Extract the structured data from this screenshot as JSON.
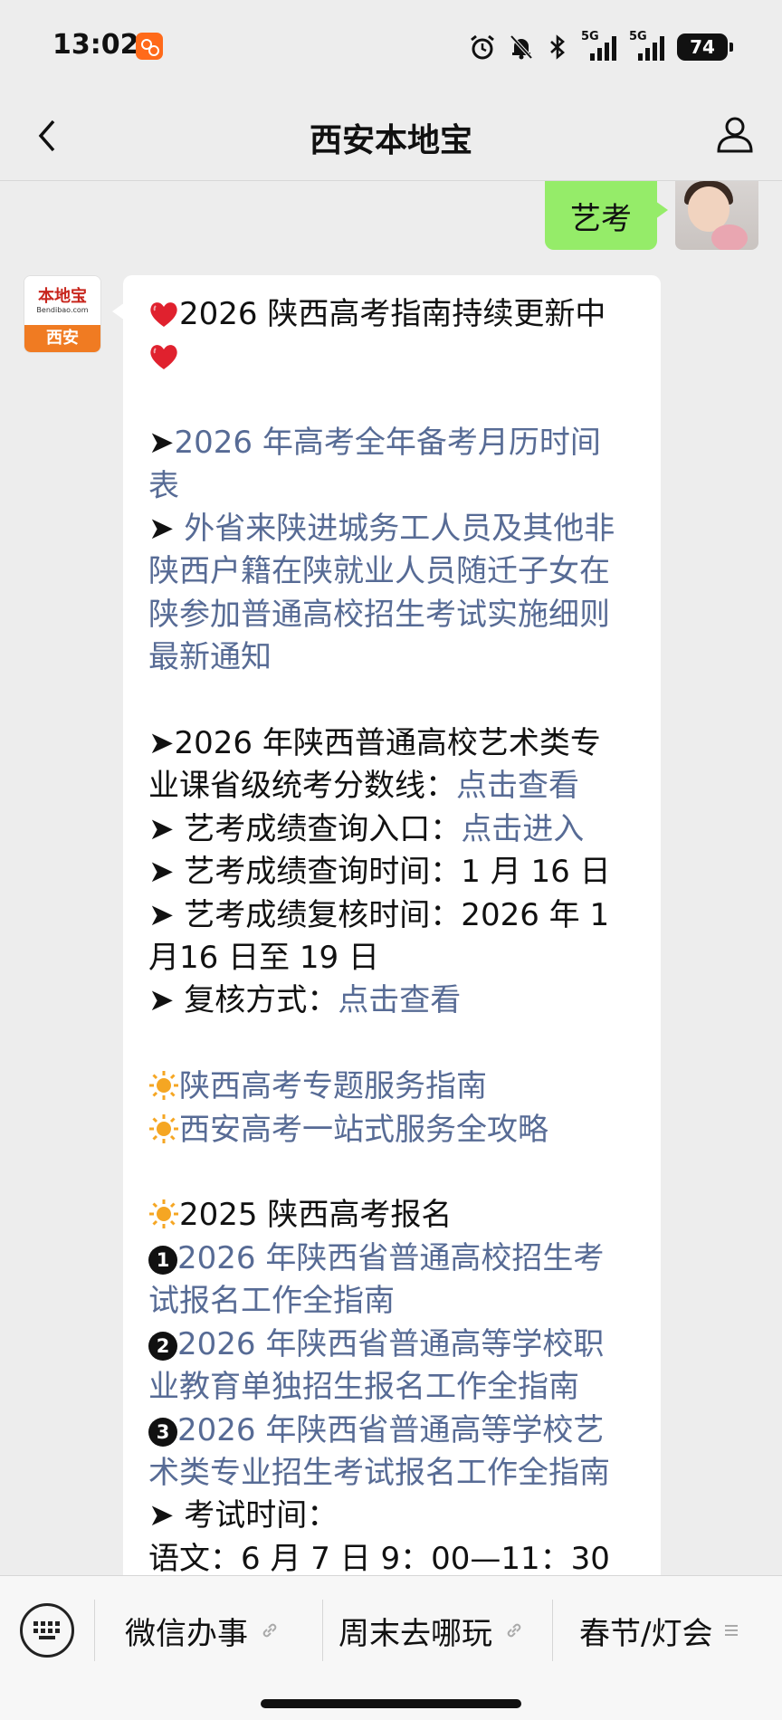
{
  "status_bar": {
    "time": "13:02",
    "network_1": "5G",
    "network_2": "5G",
    "battery": "74",
    "icons": [
      "app-badge-icon",
      "alarm-icon",
      "bell-off-icon",
      "bluetooth-icon",
      "signal-icon",
      "signal-icon",
      "battery-icon"
    ]
  },
  "nav": {
    "title": "西安本地宝",
    "back_icon": "chevron-left-icon",
    "profile_icon": "person-icon"
  },
  "sent_message": {
    "text": "艺考"
  },
  "bot": {
    "avatar_brand": "本地宝",
    "avatar_url": "Bendibao.com",
    "avatar_city": "西安"
  },
  "message": {
    "title_a": "2026 陕西高考指南持续更新中",
    "link1_a": "2026 年高考全年备考月历时间",
    "link1_b": "表",
    "link2_a": " 外省来陕进城务工人员及其他非",
    "link2_b": "陕西户籍在陕就业人员随迁子女在",
    "link2_c": "陕参加普通高校招生考试实施细则",
    "link2_d": "最新通知",
    "art_line_a": "2026 年陕西普通高校艺术类专",
    "art_line_b": "业课省级统考分数线：",
    "art_link": "点击查看",
    "query_label": " 艺考成绩查询入口：",
    "query_link": "点击进入",
    "time_label": " 艺考成绩查询时间：1 月 16 日",
    "review_a": " 艺考成绩复核时间：2026 年 1",
    "review_b": "月16 日至 19 日",
    "method_label": " 复核方式：",
    "method_link": "点击查看",
    "guide1": "陕西高考专题服务指南",
    "guide2": "西安高考一站式服务全攻略",
    "reg_title": "2025 陕西高考报名",
    "num1": "1",
    "reg1_a": "2026 年陕西省普通高校招生考",
    "reg1_b": "试报名工作全指南",
    "num2": "2",
    "reg2_a": "2026 年陕西省普通高等学校职",
    "reg2_b": "业教育单独招生报名工作全指南",
    "num3": "3",
    "reg3_a": "2026 年陕西省普通高等学校艺",
    "reg3_b": "术类专业招生考试报名工作全指南",
    "exam_time_label": " 考试时间：",
    "chinese_time": "语文：6 月 7 日 9：00—11：30"
  },
  "bottom_menu": {
    "items": [
      {
        "label": "微信办事",
        "icon": "link-icon"
      },
      {
        "label": "周末去哪玩",
        "icon": "link-icon"
      },
      {
        "label": "春节/灯会",
        "icon": "menu-lines-icon"
      }
    ],
    "keyboard_icon": "keyboard-icon"
  },
  "colors": {
    "background": "#ededed",
    "sent_bubble": "#95ec69",
    "link": "#576b95",
    "heart": "#e0212e",
    "sun": "#f5a623"
  }
}
